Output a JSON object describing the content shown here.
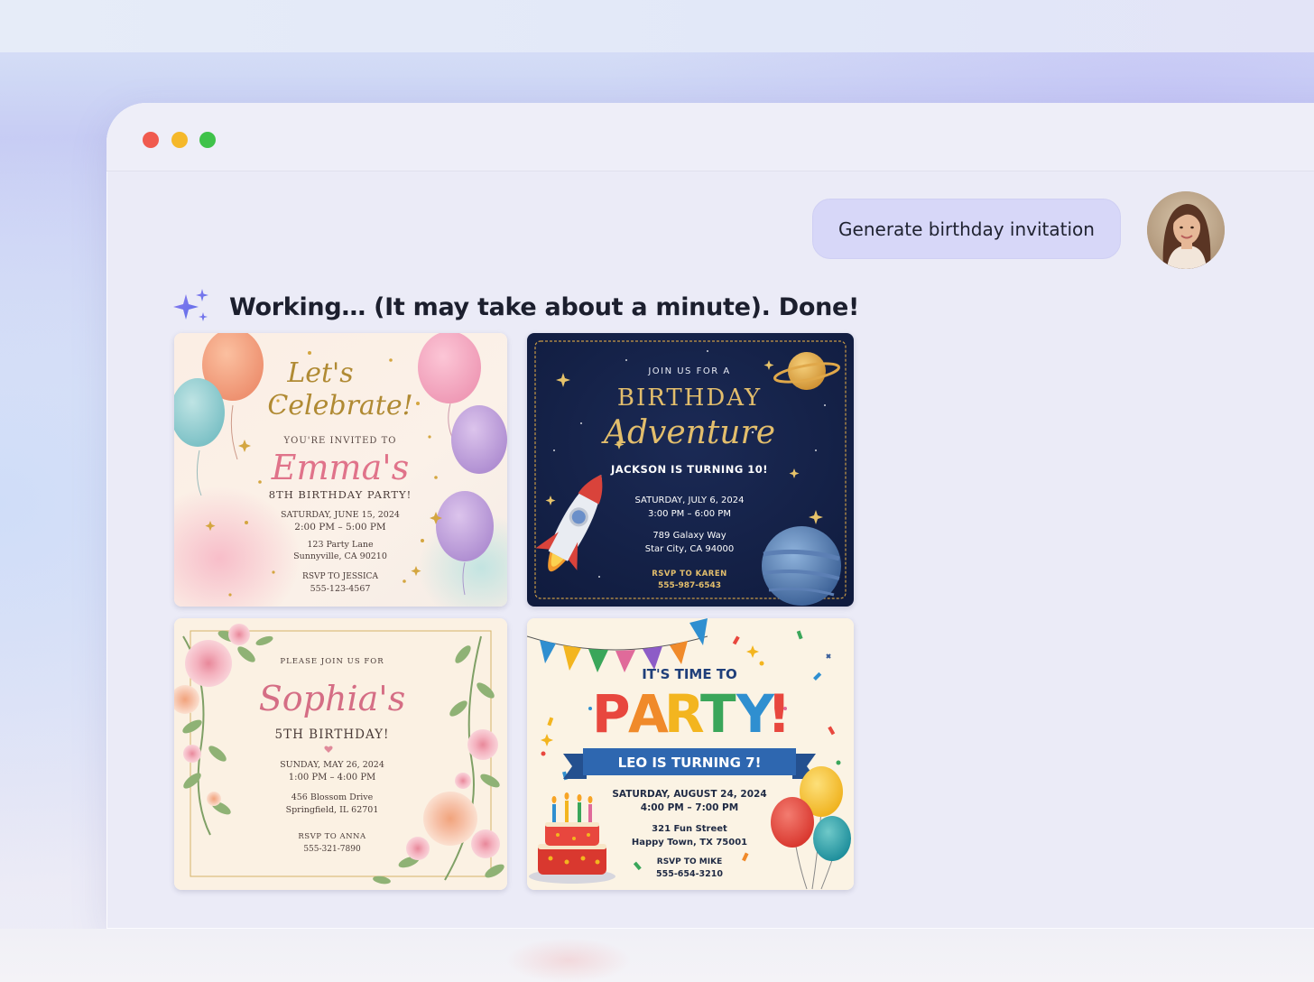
{
  "user_message": "Generate birthday invitation",
  "assistant_status": "Working… (It may take about a minute). Done!",
  "icons": {
    "spark": "sparkles-icon",
    "avatar": "user-avatar"
  },
  "invitations": [
    {
      "name": "emma",
      "heading_1": "Let's",
      "heading_2": "Celebrate!",
      "invited": "YOU'RE INVITED TO",
      "child": "Emma's",
      "occasion": "8TH BIRTHDAY PARTY!",
      "date": "SATURDAY, JUNE 15, 2024",
      "time": "2:00 PM – 5:00 PM",
      "address_1": "123 Party Lane",
      "address_2": "Sunnyville, CA 90210",
      "rsvp": "RSVP TO JESSICA",
      "phone": "555-123-4567"
    },
    {
      "name": "jackson",
      "pre": "JOIN US FOR A",
      "title_1": "BIRTHDAY",
      "title_2": "Adventure",
      "turning": "JACKSON IS TURNING 10!",
      "date": "SATURDAY, JULY 6, 2024",
      "time": "3:00 PM – 6:00 PM",
      "address_1": "789 Galaxy Way",
      "address_2": "Star City, CA 94000",
      "rsvp": "RSVP TO KAREN",
      "phone": "555-987-6543"
    },
    {
      "name": "sophia",
      "pre": "PLEASE JOIN US FOR",
      "child": "Sophia's",
      "occasion": "5TH BIRTHDAY!",
      "date": "SUNDAY, MAY 26, 2024",
      "time": "1:00 PM – 4:00 PM",
      "address_1": "456 Blossom Drive",
      "address_2": "Springfield, IL 62701",
      "rsvp": "RSVP TO ANNA",
      "phone": "555-321-7890"
    },
    {
      "name": "leo",
      "pre": "IT'S TIME TO",
      "party_letters": [
        "P",
        "A",
        "R",
        "T",
        "Y",
        "!"
      ],
      "party_colors": [
        "#e8473e",
        "#f08a2a",
        "#f3b51f",
        "#3aa65a",
        "#2f8fd0",
        "#e8473e"
      ],
      "banner": "LEO IS TURNING 7!",
      "date": "SATURDAY, AUGUST 24, 2024",
      "time": "4:00 PM – 7:00 PM",
      "address_1": "321 Fun Street",
      "address_2": "Happy Town, TX 75001",
      "rsvp": "RSVP TO MIKE",
      "phone": "555-654-3210"
    }
  ]
}
